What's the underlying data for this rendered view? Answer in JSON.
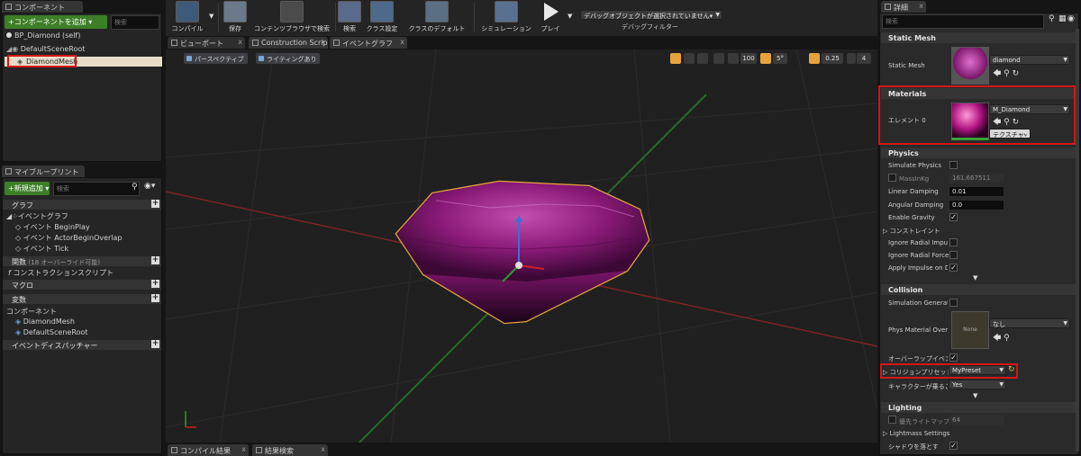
{
  "colors": {
    "accent_green": "#3c7f27",
    "highlight_red": "#d41616",
    "selection_orange": "#e6a33c",
    "diamond": "#8a1a78"
  },
  "left": {
    "components_tab": "コンポーネント",
    "add_component": "+コンポーネントを追加 ▾",
    "search_placeholder": "検索",
    "self_item": "BP_Diamond (self)",
    "root_item": "DefaultSceneRoot",
    "mesh_item": "DiamondMesh"
  },
  "myblueprint": {
    "tab": "マイブループリント",
    "new_add": "+新規追加 ▾",
    "search_placeholder": "検索",
    "graph_header": "グラフ",
    "event_graph": "イベントグラフ",
    "events": [
      "イベント BeginPlay",
      "イベント ActorBeginOverlap",
      "イベント Tick"
    ],
    "functions_header": "関数",
    "functions_note": "(18 オーバーライド可能)",
    "construction_script": "コンストラクションスクリプト",
    "macros_header": "マクロ",
    "variables_header": "変数",
    "components_header": "コンポーネント",
    "comp_items": [
      "DiamondMesh",
      "DefaultSceneRoot"
    ],
    "dispatchers_header": "イベントディスパッチャー"
  },
  "toolbar": {
    "items": [
      "コンパイル",
      "保存",
      "コンテンツブラウザで検索",
      "検索",
      "クラス設定",
      "クラスのデフォルト",
      "シミュレーション",
      "プレイ"
    ],
    "debug_select": "デバッグオブジェクトが選択されていません▾",
    "debug_filter": "デバッグフィルター"
  },
  "editor_tabs": [
    "ビューポート",
    "Construction Scrip",
    "イベントグラフ"
  ],
  "viewport": {
    "perspective": "パースペクティブ",
    "lighting": "ライティングあり",
    "snap_grid": "100",
    "snap_rot": "5°",
    "snap_scale": "0.25",
    "cam_speed": "4"
  },
  "bottom_tabs": [
    "コンパイル結果",
    "結果検索"
  ],
  "details": {
    "tab": "詳細",
    "search_placeholder": "検索",
    "static_mesh": {
      "header": "Static Mesh",
      "label": "Static Mesh",
      "value": "diamond"
    },
    "materials": {
      "header": "Materials",
      "label": "エレメント 0",
      "value": "M_Diamond",
      "texture": "テクスチャ▾"
    },
    "physics": {
      "header": "Physics",
      "simulate": "Simulate Physics",
      "mass_label": "MassInKg",
      "mass_value": "161.667511",
      "linear_label": "Linear Damping",
      "linear_value": "0.01",
      "angular_label": "Angular Damping",
      "angular_value": "0.0",
      "gravity": "Enable Gravity",
      "constraints": "コンストレイント",
      "radial_impulse": "Ignore Radial Impulse",
      "radial_force": "Ignore Radial Force",
      "apply_impulse": "Apply Impulse on Dam"
    },
    "collision": {
      "header": "Collision",
      "sim_gen": "Simulation Generates",
      "phys_mat_label": "Phys Material Overrid",
      "phys_mat_thumb": "None",
      "phys_mat_value": "なし",
      "overlap": "オーバーラップイベン",
      "preset_label": "コリジョンプリセット",
      "preset_value": "MyPreset",
      "char_label": "キャラクターが乗るこ",
      "char_value": "Yes"
    },
    "lighting": {
      "header": "Lighting",
      "lightmap_label": "優先ライトマップ",
      "lightmap_value": "64",
      "lightmass": "Lightmass Settings",
      "cast_shadow": "シャドウを落とす"
    }
  }
}
